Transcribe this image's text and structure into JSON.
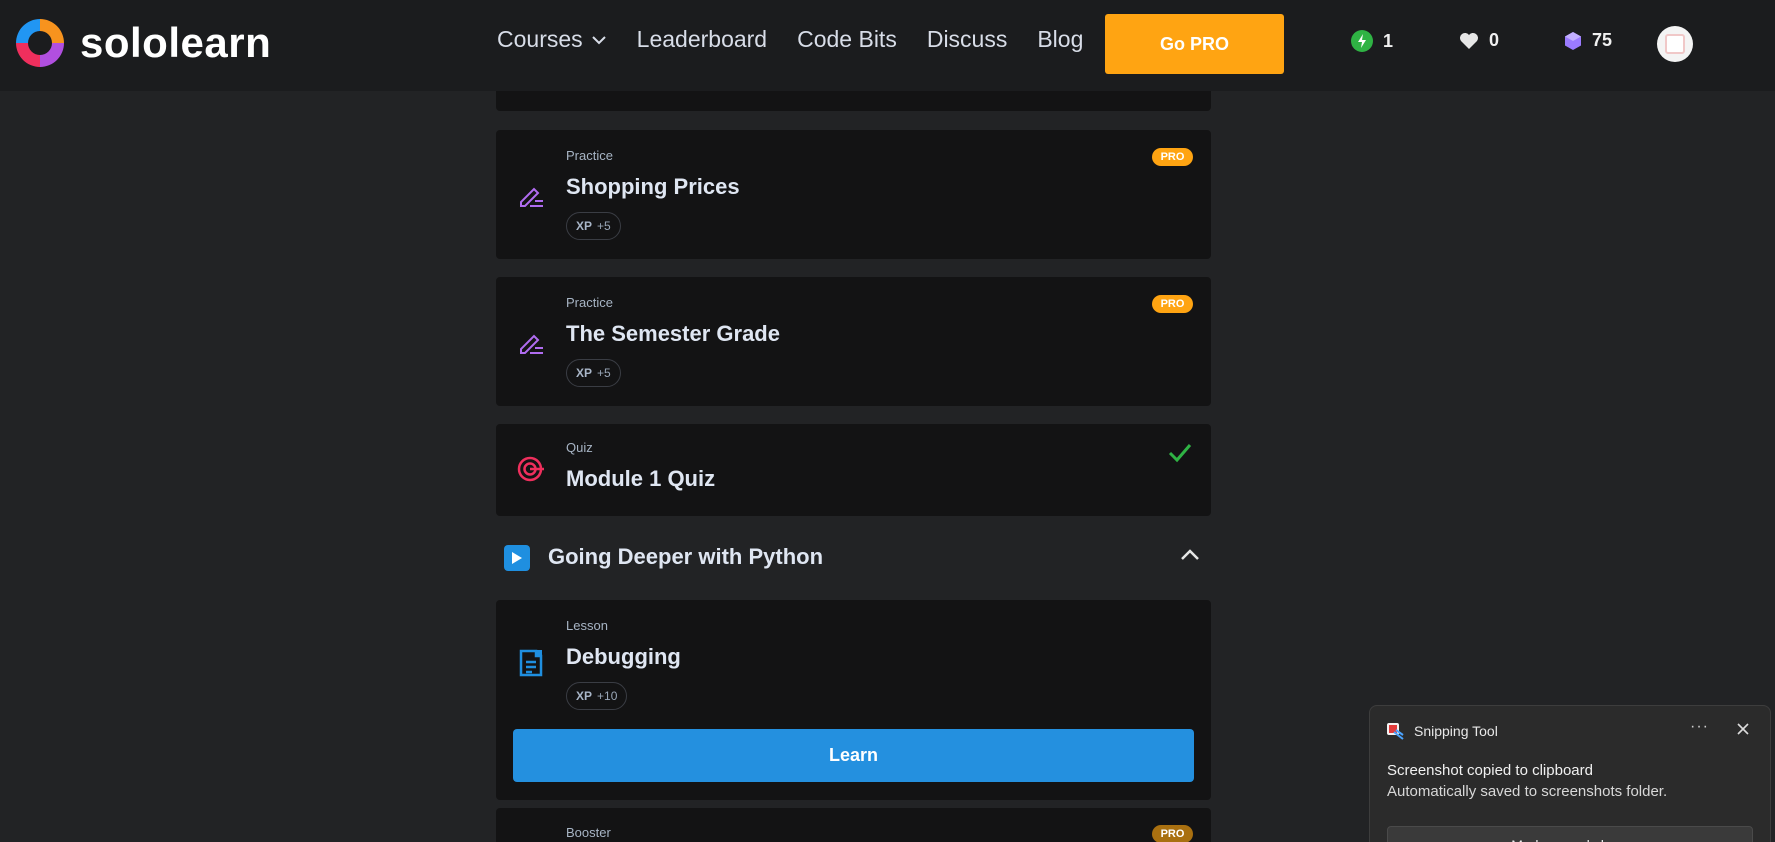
{
  "header": {
    "brand": "sololearn",
    "nav": [
      {
        "label": "Courses"
      },
      {
        "label": "Leaderboard"
      },
      {
        "label": "Code Bits"
      },
      {
        "label": "Discuss"
      },
      {
        "label": "Blog"
      }
    ],
    "go_pro_label": "Go PRO",
    "stats": {
      "streak": "1",
      "hearts": "0",
      "gems": "75"
    },
    "colors": {
      "accent": "#ffa412",
      "background": "#1b1c1e"
    }
  },
  "cards": [
    {
      "type": "Practice",
      "title": "Shopping Prices",
      "xp_label": "XP",
      "xp_value": "+5",
      "badge": "PRO",
      "icon": "pencil-lines-icon"
    },
    {
      "type": "Practice",
      "title": "The Semester Grade",
      "xp_label": "XP",
      "xp_value": "+5",
      "badge": "PRO",
      "icon": "pencil-lines-icon"
    },
    {
      "type": "Quiz",
      "title": "Module 1 Quiz",
      "status": "completed",
      "icon": "target-icon"
    }
  ],
  "section": {
    "title": "Going Deeper with Python",
    "expanded": true
  },
  "lesson": {
    "type": "Lesson",
    "title": "Debugging",
    "xp_label": "XP",
    "xp_value": "+10",
    "action_label": "Learn",
    "icon": "document-icon"
  },
  "next_card": {
    "type": "Booster",
    "badge": "PRO"
  },
  "toast": {
    "app_name": "Snipping Tool",
    "more": "···",
    "heading": "Screenshot copied to clipboard",
    "subtext": "Automatically saved to screenshots folder.",
    "button_label": "Mark-up and share"
  }
}
